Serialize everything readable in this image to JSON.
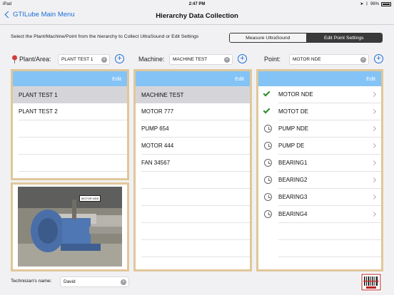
{
  "status_bar": {
    "device": "iPad",
    "time": "2:47 PM",
    "battery": "96%"
  },
  "nav": {
    "back_label": "GTILube Main Menu",
    "title": "Hierarchy Data Collection"
  },
  "instruction": "Select the Plant/Machine/Point from the hierarchy to Collect UltraSound or Edit Settings",
  "segments": [
    {
      "label": "Measure UltraSound",
      "active": false
    },
    {
      "label": "Edit Point Settings",
      "active": true
    }
  ],
  "plant": {
    "label": "Plant/Area:",
    "search_value": "PLANT TEST 1",
    "edit_label": "Edit",
    "items": [
      "PLANT TEST 1",
      "PLANT TEST 2"
    ],
    "selected_index": 0
  },
  "machine": {
    "label": "Machine:",
    "search_value": "MACHINE TEST",
    "edit_label": "Edit",
    "items": [
      "MACHINE TEST",
      "MOTOR 777",
      "PUMP 654",
      "MOTOR 444",
      "FAN 34567"
    ],
    "selected_index": 0
  },
  "point": {
    "label": "Point:",
    "search_value": "MOTOR NDE",
    "edit_label": "Edit",
    "items": [
      {
        "name": "MOTOR NDE",
        "status": "check"
      },
      {
        "name": "MOTOT DE",
        "status": "check"
      },
      {
        "name": "PUMP NDE",
        "status": "clock"
      },
      {
        "name": "PUMP DE",
        "status": "clock"
      },
      {
        "name": "BEARING1",
        "status": "clock"
      },
      {
        "name": "BEARING2",
        "status": "clock"
      },
      {
        "name": "BEARING3",
        "status": "clock"
      },
      {
        "name": "BEARING4",
        "status": "clock"
      }
    ]
  },
  "photo_tag": "MOTOR NDE",
  "technician": {
    "label": "Technician's name:",
    "value": "David"
  },
  "colors": {
    "accent": "#1a6fd8",
    "panel_header": "#84c3f5",
    "panel_border": "#e0c79a",
    "check": "#2b8a2b"
  }
}
